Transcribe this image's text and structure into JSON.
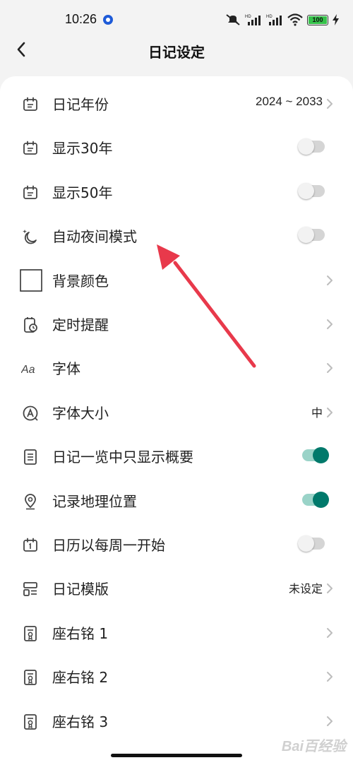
{
  "status_bar": {
    "time": "10:26",
    "battery": "100",
    "battery_level": 1.0,
    "icons": [
      "silent-icon",
      "hd-signal-icon",
      "hd-signal-icon",
      "wifi-icon",
      "battery-icon",
      "charging-icon"
    ]
  },
  "header": {
    "title": "日记设定",
    "back_icon": "back-arrow-icon"
  },
  "settings": [
    {
      "id": "diary-years",
      "icon": "calendar-icon",
      "label": "日记年份",
      "value": "2024 ~ 2033",
      "control": "chevron"
    },
    {
      "id": "show-30-years",
      "icon": "calendar-icon",
      "label": "显示30年",
      "control": "toggle",
      "on": false
    },
    {
      "id": "show-50-years",
      "icon": "calendar-icon",
      "label": "显示50年",
      "control": "toggle",
      "on": false
    },
    {
      "id": "auto-night-mode",
      "icon": "moon-icon",
      "label": "自动夜间模式",
      "control": "toggle",
      "on": false
    },
    {
      "id": "background-color",
      "icon": "color-swatch-icon",
      "label": "背景颜色",
      "control": "chevron"
    },
    {
      "id": "timed-reminder",
      "icon": "alarm-icon",
      "label": "定时提醒",
      "control": "chevron"
    },
    {
      "id": "font",
      "icon": "font-icon",
      "label": "字体",
      "control": "chevron"
    },
    {
      "id": "font-size",
      "icon": "font-size-icon",
      "label": "字体大小",
      "value": "中",
      "control": "chevron"
    },
    {
      "id": "list-summary-only",
      "icon": "list-icon",
      "label": "日记一览中只显示概要",
      "control": "toggle",
      "on": true
    },
    {
      "id": "record-location",
      "icon": "location-icon",
      "label": "记录地理位置",
      "control": "toggle",
      "on": true
    },
    {
      "id": "week-starts-monday",
      "icon": "calendar-one-icon",
      "label": "日历以每周一开始",
      "control": "toggle",
      "on": false
    },
    {
      "id": "diary-template",
      "icon": "template-icon",
      "label": "日记模版",
      "value": "未设定",
      "control": "chevron"
    },
    {
      "id": "motto-1",
      "icon": "certificate-icon",
      "label": "座右铭 1",
      "control": "chevron"
    },
    {
      "id": "motto-2",
      "icon": "certificate-icon",
      "label": "座右铭 2",
      "control": "chevron"
    },
    {
      "id": "motto-3",
      "icon": "certificate-icon",
      "label": "座右铭 3",
      "control": "chevron"
    }
  ],
  "colors": {
    "accent": "#00796b",
    "accent_track": "#9ad3c8",
    "annotation_arrow": "#e8394b"
  },
  "watermark": "Bai百经验"
}
